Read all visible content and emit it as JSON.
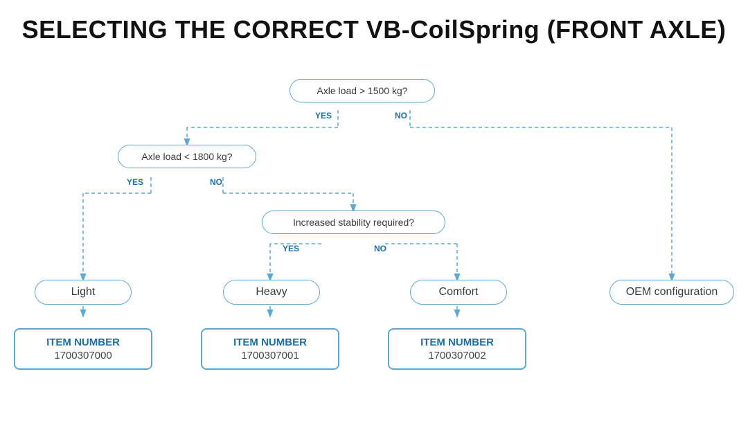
{
  "title": "SELECTING THE CORRECT VB-CoilSpring (FRONT AXLE)",
  "decision1": {
    "text": "Axle load > 1500 kg?",
    "yes": "YES",
    "no": "NO"
  },
  "decision2": {
    "text": "Axle load < 1800 kg?",
    "yes": "YES",
    "no": "NO"
  },
  "decision3": {
    "text": "Increased stability required?",
    "yes": "YES",
    "no": "NO"
  },
  "results": {
    "light": "Light",
    "heavy": "Heavy",
    "comfort": "Comfort",
    "oem": "OEM configuration"
  },
  "items": {
    "item0": {
      "label": "ITEM NUMBER",
      "number": "1700307000"
    },
    "item1": {
      "label": "ITEM NUMBER",
      "number": "1700307001"
    },
    "item2": {
      "label": "ITEM NUMBER",
      "number": "1700307002"
    }
  }
}
